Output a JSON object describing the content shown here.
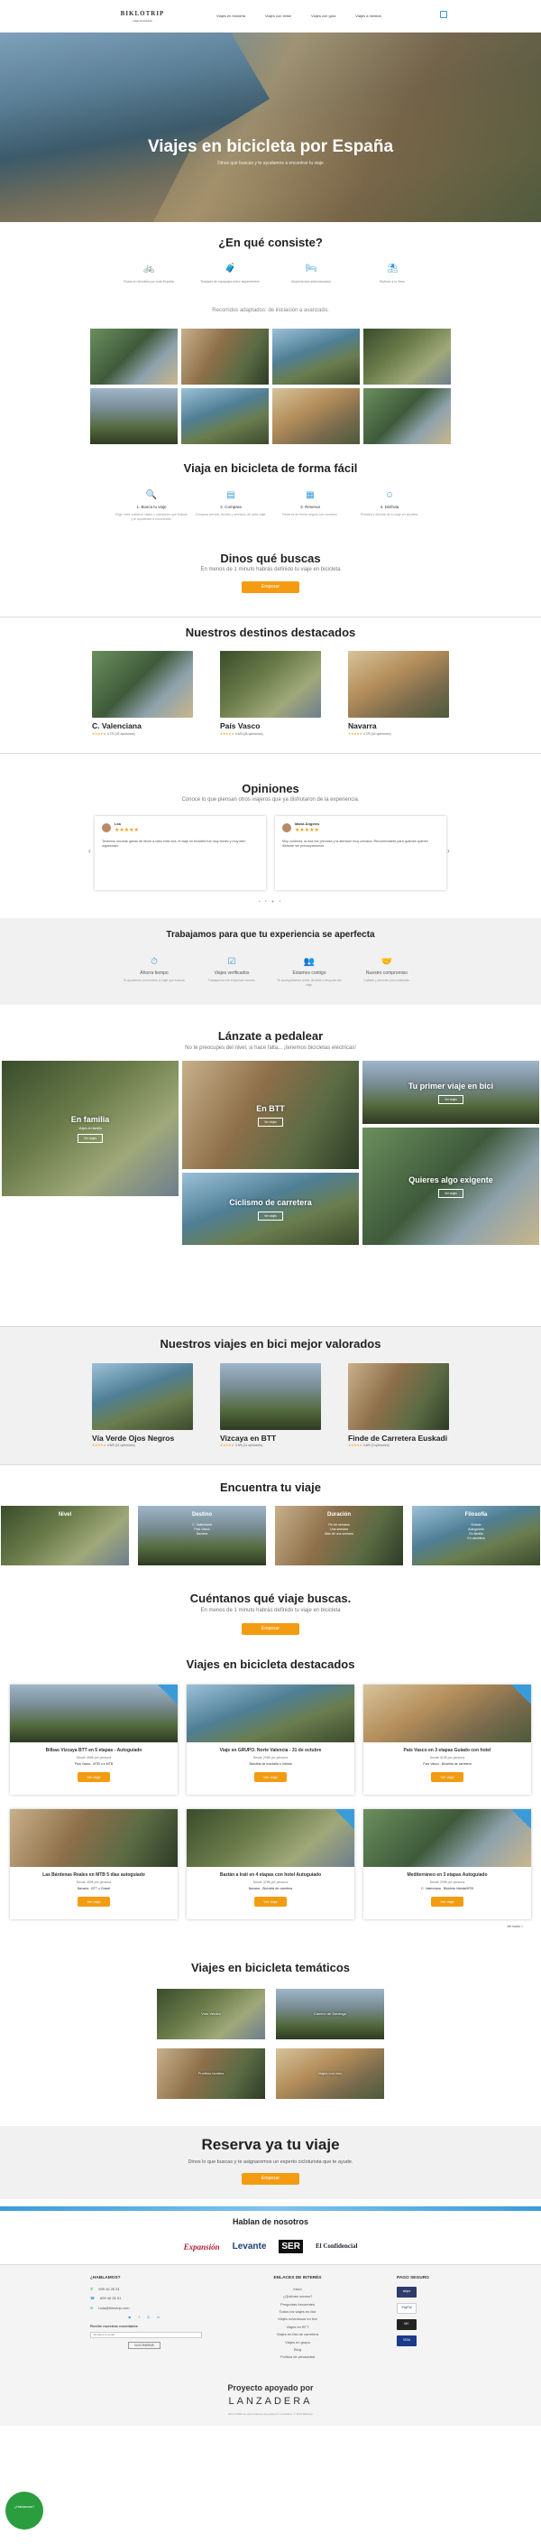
{
  "header": {
    "logo": "BIKLOTRIP",
    "logo_tag": "viajes en bicicleta",
    "nav": [
      "Viajes en bicicleta",
      "Viajes con ebike",
      "Viajes con guía",
      "Viajes a medida"
    ]
  },
  "hero": {
    "title": "Viajes en bicicleta por España",
    "subtitle": "Dinos qué buscas y te ayudamos a encontrar tu viaje"
  },
  "consist": {
    "title": "¿En qué consiste?",
    "features": [
      {
        "icon": "bike-icon",
        "text": "Rutas en bicicleta por toda España"
      },
      {
        "icon": "luggage-icon",
        "text": "Traslado de equipajes entre alojamientos"
      },
      {
        "icon": "hotel-icon",
        "text": "Alojamientos seleccionados"
      },
      {
        "icon": "beach-icon",
        "text": "Disfruta a tu ritmo"
      }
    ],
    "note": "Recorridos adaptados: de iniciación a avanzado."
  },
  "viaja": {
    "title": "Viaja en bicicleta de forma fácil",
    "steps": [
      {
        "icon": "search-icon",
        "title": "1. Busca tu viaje",
        "text": "Elige entre nuestros viajes o cuéntanos qué buscas y te ayudamos a encontrarlo."
      },
      {
        "icon": "compare-icon",
        "title": "2. Compara",
        "text": "Compara precios, fechas y servicios de cada viaje."
      },
      {
        "icon": "calendar-icon",
        "title": "3. Reserva",
        "text": "Reserva de forma segura con nosotros."
      },
      {
        "icon": "smile-icon",
        "title": "4. Disfruta",
        "text": "Pedalea y disfruta de tu viaje en bicicleta."
      }
    ]
  },
  "dinos": {
    "title": "Dinos qué buscas",
    "subtitle": "En menos de 1 minuto habrás definido tu viaje en bicicleta",
    "button": "Empezar"
  },
  "destinos": {
    "title": "Nuestros destinos destacados",
    "cards": [
      {
        "name": "C. Valenciana",
        "rating": "4.7/5 (33 opiniones)"
      },
      {
        "name": "País Vasco",
        "rating": "4.6/5 (28 opiniones)"
      },
      {
        "name": "Navarra",
        "rating": "4.7/5 (15 opiniones)"
      }
    ]
  },
  "opiniones": {
    "title": "Opiniones",
    "subtitle": "Conoce lo que piensan otros viajeros que ya disfrutaron de la experiencia.",
    "reviews": [
      {
        "name": "Lea",
        "text": "Tenemos muchas ganas de llevar a cabo esta ruta, el viaje en bicicleta fue muy bonito y muy bien organizado."
      },
      {
        "name": "María Ángeles",
        "text": "Muy contenta, la ruta fue preciosa y la atención muy cercana. Recomendable para quienes quieren disfrutar sin preocupaciones."
      }
    ]
  },
  "trabajamos": {
    "title": "Trabajamos para que tu experiencia se aperfecta",
    "items": [
      {
        "icon": "clock-icon",
        "title": "Ahorra tiempo",
        "text": "Te ayudamos a encontrar el viaje que buscas."
      },
      {
        "icon": "check-list-icon",
        "title": "Viajes verificados",
        "text": "Trabajamos con empresas locales."
      },
      {
        "icon": "team-icon",
        "title": "Estamos contigo",
        "text": "Te acompañamos antes, durante y después del viaje."
      },
      {
        "icon": "handshake-icon",
        "title": "Nuestro compromiso",
        "text": "Calidad y atención personalizada."
      }
    ]
  },
  "lanzate": {
    "title": "Lánzate a pedalear",
    "subtitle": "No te preocupes del nivel, si hace falta... ¡tenemos bicicletas eléctricas!",
    "tiles": [
      {
        "label": "En familia",
        "sub": "Viajes en familia",
        "button": "Ver viajes"
      },
      {
        "label": "En BTT",
        "sub": "",
        "button": "Ver viajes"
      },
      {
        "label": "Tu primer viaje en bici",
        "sub": "",
        "button": "Ver viajes"
      },
      {
        "label": "Ciclismo de carretera",
        "sub": "",
        "button": "Ver viajes"
      },
      {
        "label": "Quieres algo exigente",
        "sub": "",
        "button": "Ver viajes"
      }
    ]
  },
  "valorados": {
    "title": "Nuestros viajes en bici mejor valorados",
    "cards": [
      {
        "name": "Vía Verde Ojos Negros",
        "rating": "4.8/5 (14 opiniones)"
      },
      {
        "name": "Vizcaya en BTT",
        "rating": "4.9/5 (11 opiniones)"
      },
      {
        "name": "Finde de Carretera Euskadi",
        "rating": "4.8/5 (9 opiniones)"
      }
    ]
  },
  "encuentra": {
    "title": "Encuentra tu viaje",
    "items": [
      {
        "label": "Nivel",
        "lines": []
      },
      {
        "label": "Destino",
        "lines": [
          "C. Valenciana",
          "País Vasco",
          "Navarra"
        ]
      },
      {
        "label": "Duración",
        "lines": [
          "Fin de semana",
          "Una semana",
          "Más de una semana"
        ]
      },
      {
        "label": "Filosofía",
        "lines": [
          "Guiado",
          "Autoguiado",
          "En familia",
          "En carretera"
        ]
      }
    ]
  },
  "cuentanos": {
    "title": "Cuéntanos qué viaje buscas.",
    "subtitle": "En menos de 1 minuto habrás definido tu viaje en bicicleta",
    "button": "Empezar"
  },
  "destacados": {
    "title": "Viajes en bicicleta destacados",
    "trips": [
      {
        "title": "Bilbao Vizcaya BTT en 5 etapas - Autoguiado",
        "meta": "Desde 450€ por persona",
        "place": "País Vasco - MTB o e-MTB",
        "button": "Ver viaje"
      },
      {
        "title": "Viaje en GRUPO. Norte Valencia - 31 de octubre",
        "meta": "Desde 295€ por persona",
        "place": "Bicicleta de montaña o híbrida",
        "button": "Ver viaje"
      },
      {
        "title": "País Vasco en 3 etapas Guiado con hotel",
        "meta": "Desde 410€ por persona",
        "place": "País Vasco - Bicicleta de carretera",
        "button": "Ver viaje"
      },
      {
        "title": "Las Bárdenas Reales en MTB 5 días autoguiado",
        "meta": "Desde 490€ por persona",
        "place": "Navarra - BTT o Gravel",
        "button": "Ver viaje"
      },
      {
        "title": "Baztán a Irati en 4 etapas con hotel Autoguiado",
        "meta": "Desde 475€ por persona",
        "place": "Navarra - Bicicleta de carretera",
        "button": "Ver viaje"
      },
      {
        "title": "Mediterráneo en 3 etapas Autoguiado",
        "meta": "Desde 299€ por persona",
        "place": "C. Valenciana - Bicicleta híbrida/MTB",
        "button": "Ver viaje"
      }
    ],
    "see_all": "Ver todos >"
  },
  "tematicos": {
    "title": "Viajes en bicicleta temáticos",
    "items": [
      "Vías Verdes",
      "Camino de Santiago",
      "Pueblos bonitos",
      "Viajes con vino"
    ]
  },
  "reserva": {
    "title": "Reserva ya tu viaje",
    "subtitle": "Dinos lo que buscas y te asignaremos un experto cicloturista que te ayude.",
    "button": "Empezar"
  },
  "hablan": {
    "title": "Hablan de nosotros",
    "press": [
      "Expansión",
      "Levante",
      "SER",
      "El Confidencial"
    ]
  },
  "footer": {
    "contact_title": "¿HABLAMOS?",
    "phone1": "699 46 26 51",
    "phone2": "699 46 26 51",
    "email": "hola@biklotrip.com",
    "news_title": "Recibe nuestras novedades",
    "news_placeholder": "Introduce tu email",
    "news_button": "SUSCRIBIRME",
    "links_title": "ENLACES DE INTERÉS",
    "links": [
      "Inicio",
      "¿Quiénes somos?",
      "Preguntas frecuentes",
      "Todos los viajes en bici",
      "Viajes novedosos en bici",
      "Viajes en BTT",
      "Viajes en bici de carretera",
      "Viajes en grupo",
      "Blog",
      "Política de privacidad"
    ],
    "pay_title": "PAGO SEGURO",
    "pay": [
      "stripe",
      "PayPal",
      "MC",
      "VISA"
    ]
  },
  "proyecto": {
    "title": "Proyecto apoyado por",
    "brand": "LANZADERA",
    "small": "BIKLOTRIP es una empresa apoyada por Lanzadera. © 2024 Biklotrip"
  },
  "whatsapp": {
    "label": "¿Hablamos?"
  }
}
